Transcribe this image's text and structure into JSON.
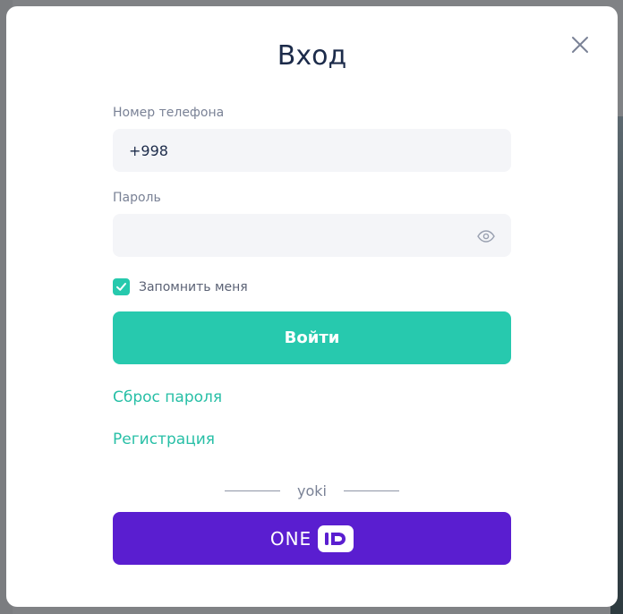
{
  "modal": {
    "title": "Вход",
    "phone": {
      "label": "Номер телефона",
      "value": "+998"
    },
    "password": {
      "label": "Пароль",
      "value": ""
    },
    "remember": {
      "label": "Запомнить меня",
      "checked": true
    },
    "login_button": "Войти",
    "reset_link": "Сброс пароля",
    "register_link": "Регистрация",
    "divider_text": "yoki",
    "oneid": {
      "text": "ONE",
      "badge": "ID"
    }
  },
  "colors": {
    "accent_teal": "#27c9ae",
    "oneid_purple": "#5a1ed0",
    "title_navy": "#1c2b4a"
  },
  "icons": {
    "close": "close-icon",
    "eye": "eye-icon",
    "check": "check-icon"
  }
}
